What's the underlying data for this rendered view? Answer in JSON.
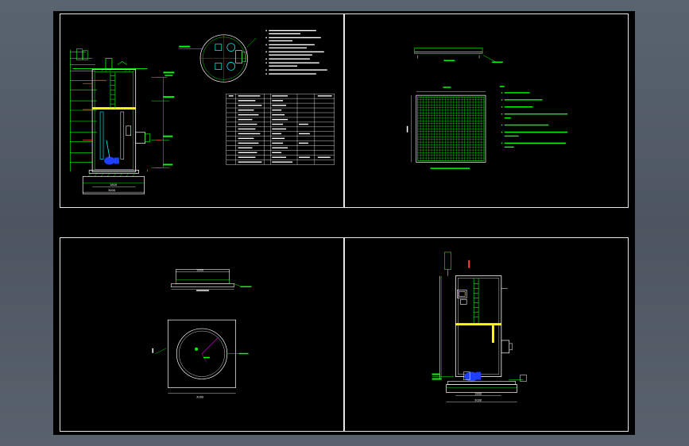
{
  "viewer": {
    "background_color": "#000000",
    "frame_color": "#ffffff",
    "accent_colors": {
      "green": "#00ff00",
      "yellow": "#ffff00",
      "red": "#ff3b3b",
      "cyan": "#00ffff",
      "blue": "#1f3fff",
      "magenta": "#ff00ff",
      "white": "#ffffff"
    }
  },
  "sheets": [
    {
      "id": "sheet-1",
      "labels": {
        "top_dim": "1:100",
        "bottom_dim": "3000",
        "sub_dim": "1800",
        "row_marks": [
          "1",
          "2",
          "3",
          "4",
          "5",
          "6",
          "7",
          "8",
          "9",
          "10",
          "11",
          "12",
          "13",
          "14",
          "15",
          "16"
        ]
      }
    },
    {
      "id": "sheet-2",
      "labels": {
        "plate_dim": "3000",
        "grid_dim": "3000"
      }
    },
    {
      "id": "sheet-3",
      "labels": {
        "lid_dim": "1800",
        "base_dim": "3000"
      }
    },
    {
      "id": "sheet-4",
      "labels": {
        "bottom_dim": "3000",
        "sub_dim": "1800"
      }
    }
  ]
}
